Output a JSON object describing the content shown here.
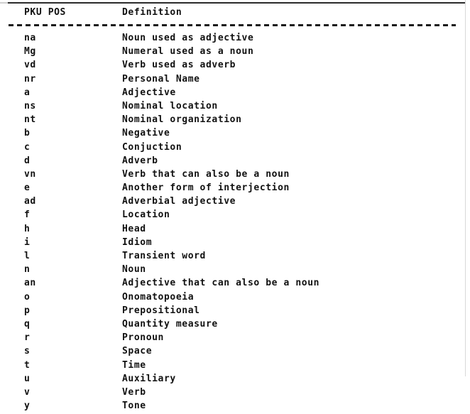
{
  "document": {
    "type": "scanned-table",
    "background_color": "#ffffff",
    "text_color": "#111111"
  },
  "table": {
    "headers": {
      "code": "PKU POS",
      "definition": "Definition"
    },
    "rows": [
      {
        "code": "na",
        "definition": "Noun used as adjective"
      },
      {
        "code": "Mg",
        "definition": "Numeral used as a noun"
      },
      {
        "code": "vd",
        "definition": "Verb used as adverb"
      },
      {
        "code": "nr",
        "definition": "Personal Name"
      },
      {
        "code": "a",
        "definition": "Adjective"
      },
      {
        "code": "ns",
        "definition": "Nominal location"
      },
      {
        "code": "nt",
        "definition": "Nominal organization"
      },
      {
        "code": "b",
        "definition": "Negative"
      },
      {
        "code": "c",
        "definition": "Conjuction"
      },
      {
        "code": "d",
        "definition": "Adverb"
      },
      {
        "code": "vn",
        "definition": "Verb that can also be a noun"
      },
      {
        "code": "e",
        "definition": "Another form of interjection"
      },
      {
        "code": "ad",
        "definition": "Adverbial adjective"
      },
      {
        "code": "f",
        "definition": "Location"
      },
      {
        "code": "h",
        "definition": "Head"
      },
      {
        "code": "i",
        "definition": "Idiom"
      },
      {
        "code": "l",
        "definition": "Transient word"
      },
      {
        "code": "n",
        "definition": "Noun"
      },
      {
        "code": "an",
        "definition": "Adjective that can also be a noun"
      },
      {
        "code": "o",
        "definition": "Onomatopoeia"
      },
      {
        "code": "p",
        "definition": "Prepositional"
      },
      {
        "code": "q",
        "definition": "Quantity measure"
      },
      {
        "code": "r",
        "definition": "Pronoun"
      },
      {
        "code": "s",
        "definition": "Space"
      },
      {
        "code": "t",
        "definition": "Time"
      },
      {
        "code": "u",
        "definition": "Auxiliary"
      },
      {
        "code": "v",
        "definition": "Verb"
      },
      {
        "code": "y",
        "definition": "Tone"
      }
    ]
  }
}
